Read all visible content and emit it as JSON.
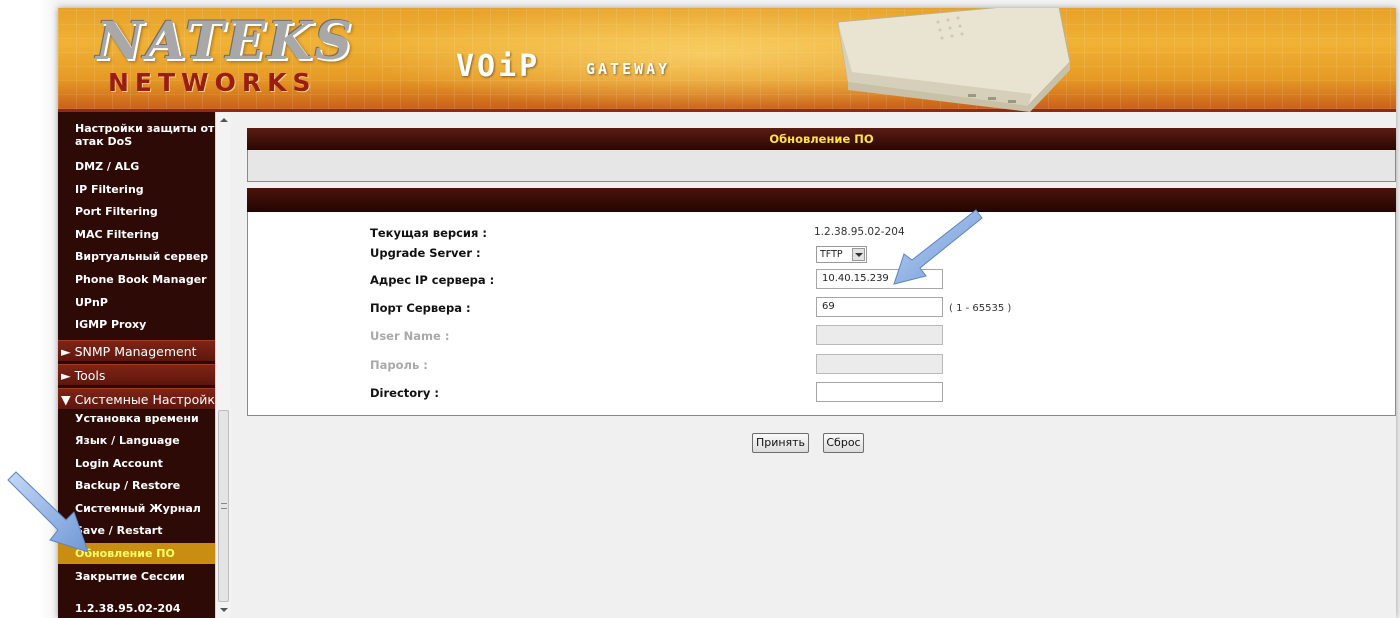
{
  "header": {
    "brand_top": "NATEKS",
    "brand_bottom": "NETWORKS",
    "product_voip": "VOiP",
    "product_gateway": "GATEWAY"
  },
  "sidebar": {
    "items_top": [
      {
        "label_line1": "Настройки защиты от",
        "label_line2": "атак DoS"
      },
      {
        "label": "DMZ / ALG"
      },
      {
        "label": "IP Filtering"
      },
      {
        "label": "Port Filtering"
      },
      {
        "label": "MAC Filtering"
      },
      {
        "label": "Виртуальный сервер"
      },
      {
        "label": "Phone Book Manager"
      },
      {
        "label": "UPnP"
      },
      {
        "label": "IGMP Proxy"
      }
    ],
    "groups": [
      {
        "label": "SNMP Management",
        "expanded": false
      },
      {
        "label": "Tools",
        "expanded": false
      },
      {
        "label": "Системные Настройки",
        "expanded": true
      }
    ],
    "system_items": [
      {
        "label": "Установка времени"
      },
      {
        "label": "Язык / Language"
      },
      {
        "label": "Login Account"
      },
      {
        "label": "Backup / Restore"
      },
      {
        "label": "Системный Журнал"
      },
      {
        "label": "Save / Restart"
      },
      {
        "label": "Обновление ПО",
        "selected": true
      },
      {
        "label": "Закрытие Сессии"
      }
    ],
    "version": "1.2.38.95.02-204",
    "icon_collapsed": "►",
    "icon_expanded": "▼"
  },
  "main": {
    "title": "Обновление ПО",
    "form": {
      "current_version_label": "Текущая версия :",
      "current_version_value": "1.2.38.95.02-204",
      "upgrade_server_label": "Upgrade Server :",
      "upgrade_server_value": "TFTP",
      "server_ip_label": "Адрес IP сервера :",
      "server_ip_value": "10.40.15.239",
      "server_port_label": "Порт Сервера :",
      "server_port_value": "69",
      "server_port_hint": "( 1 - 65535 )",
      "user_name_label": "User Name :",
      "user_name_value": "",
      "password_label": "Пароль :",
      "password_value": "",
      "directory_label": "Directory :",
      "directory_value": ""
    },
    "buttons": {
      "apply": "Принять",
      "reset": "Сброс"
    }
  },
  "colors": {
    "accent_orange": "#e69a25",
    "sidebar_bg": "#2e0a06",
    "selected_bg": "#c88d11",
    "selected_text": "#ffff66",
    "title_text": "#ffe24a",
    "annotation_arrow": "#8fb4e8"
  }
}
